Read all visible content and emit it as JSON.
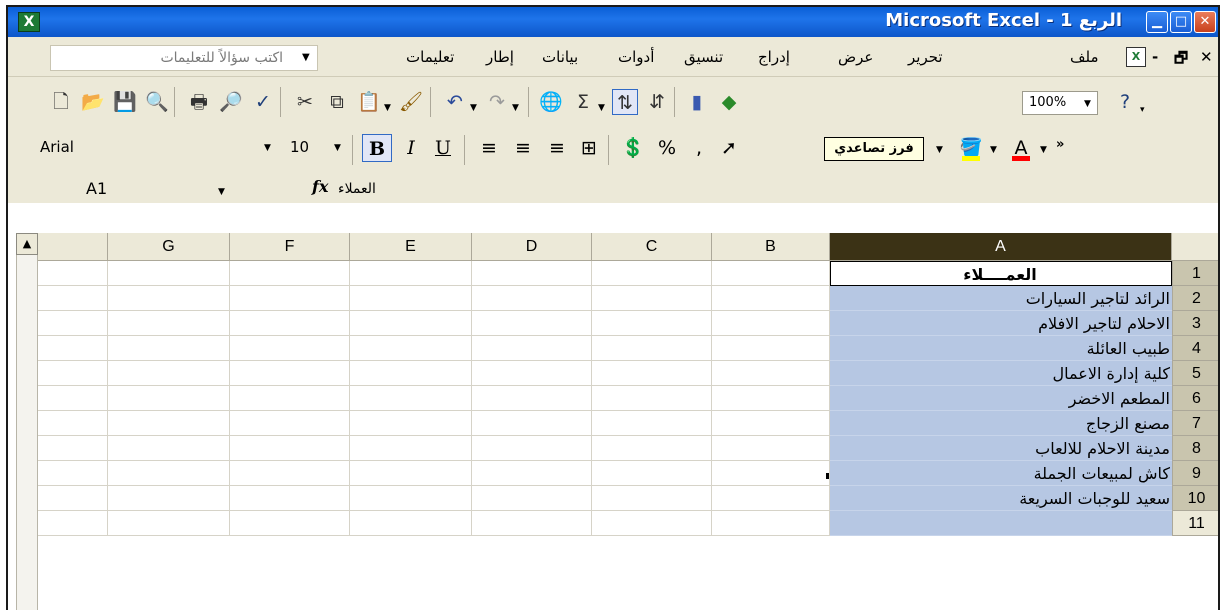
{
  "window": {
    "title": "Microsoft Excel - الربع 1",
    "controls": [
      "minimize",
      "maximize",
      "close"
    ]
  },
  "menubar": {
    "ask_placeholder": "اكتب سؤالاً للتعليمات",
    "items": [
      "ملف",
      "تحرير",
      "عرض",
      "إدراج",
      "تنسيق",
      "أدوات",
      "بيانات",
      "إطار",
      "تعليمات"
    ]
  },
  "toolbar": {
    "zoom": "100%",
    "icons": [
      "new-icon",
      "open-icon",
      "save-icon",
      "permission-icon",
      "print-icon",
      "print-preview-icon",
      "spelling-icon",
      "cut-icon",
      "copy-icon",
      "paste-icon",
      "format-painter-icon",
      "undo-icon",
      "redo-icon",
      "hyperlink-icon",
      "autosum-icon",
      "sort-descending-icon",
      "sort-ascending-icon",
      "chart-wizard-icon",
      "drawing-icon",
      "help-icon"
    ]
  },
  "format_toolbar": {
    "font": "Arial",
    "size": "10",
    "tooltip": "فرز تصاعدي"
  },
  "formula_bar": {
    "namebox": "A1",
    "fx": "fx",
    "content": "العملاء"
  },
  "grid": {
    "columns": [
      "G",
      "F",
      "E",
      "D",
      "C",
      "B",
      "A"
    ],
    "selected_column": "A",
    "rows": [
      {
        "num": "1",
        "a": "العمــــلاء"
      },
      {
        "num": "2",
        "a": "الرائد لتاجير السيارات"
      },
      {
        "num": "3",
        "a": "الاحلام لتاجير الافلام"
      },
      {
        "num": "4",
        "a": "طبيب العائلة"
      },
      {
        "num": "5",
        "a": "كلية إدارة الاعمال"
      },
      {
        "num": "6",
        "a": "المطعم الاخضر"
      },
      {
        "num": "7",
        "a": "مصنع الزجاج"
      },
      {
        "num": "8",
        "a": "مدينة الاحلام للالعاب"
      },
      {
        "num": "9",
        "a": "كاش لمبيعات الجملة"
      },
      {
        "num": "10",
        "a": "سعيد للوجبات السريعة"
      },
      {
        "num": "11",
        "a": ""
      }
    ]
  },
  "colors": {
    "titlebar": "#0a5fd6",
    "selection": "#b6c7e3",
    "selected_column_header": "#3b3215"
  }
}
